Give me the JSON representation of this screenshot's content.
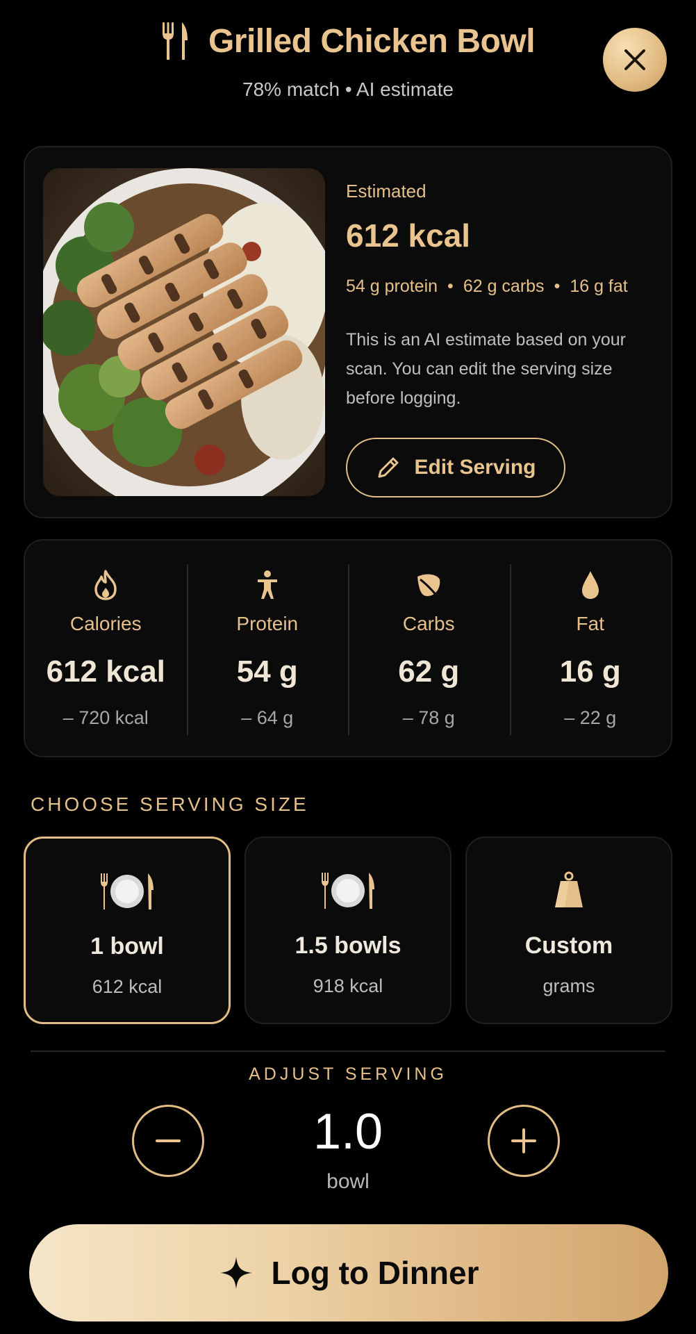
{
  "header": {
    "title": "Grilled Chicken Bowl",
    "subtitle": "78% match • AI estimate",
    "title_icon": "fork-knife-icon",
    "close_icon": "close-icon"
  },
  "hero": {
    "estimated_label": "Estimated",
    "kcal": "612 kcal",
    "protein": "54 g protein",
    "carbs": "62 g carbs",
    "fat": "16 g fat",
    "note": "This is an AI estimate based on your scan. You can edit the serving size before logging.",
    "edit_button_label": "Edit Serving",
    "edit_icon": "pencil-icon"
  },
  "macros": [
    {
      "icon": "flame-icon",
      "name": "Calories",
      "value": "612 kcal",
      "sub": "– 720 kcal"
    },
    {
      "icon": "person-icon",
      "name": "Protein",
      "value": "54 g",
      "sub": "– 64 g"
    },
    {
      "icon": "leaf-icon",
      "name": "Carbs",
      "value": "62 g",
      "sub": "– 78 g"
    },
    {
      "icon": "drop-icon",
      "name": "Fat",
      "value": "16 g",
      "sub": "– 22 g"
    }
  ],
  "serving": {
    "section_label": "CHOOSE SERVING SIZE",
    "options": [
      {
        "icon": "plate-icon",
        "name": "1 bowl",
        "sub": "612 kcal",
        "selected": true
      },
      {
        "icon": "plate-icon",
        "name": "1.5 bowls",
        "sub": "918 kcal",
        "selected": false
      },
      {
        "icon": "weight-icon",
        "name": "Custom",
        "sub": "grams",
        "selected": false
      }
    ]
  },
  "adjust": {
    "label": "ADJUST SERVING",
    "value": "1.0",
    "unit": "bowl",
    "minus_icon": "minus-icon",
    "plus_icon": "plus-icon"
  },
  "log_button": {
    "label": "Log to Dinner",
    "icon": "sparkle-icon"
  },
  "colors": {
    "accent": "#e9c48e",
    "background": "#000000",
    "card": "#0b0b0c"
  }
}
